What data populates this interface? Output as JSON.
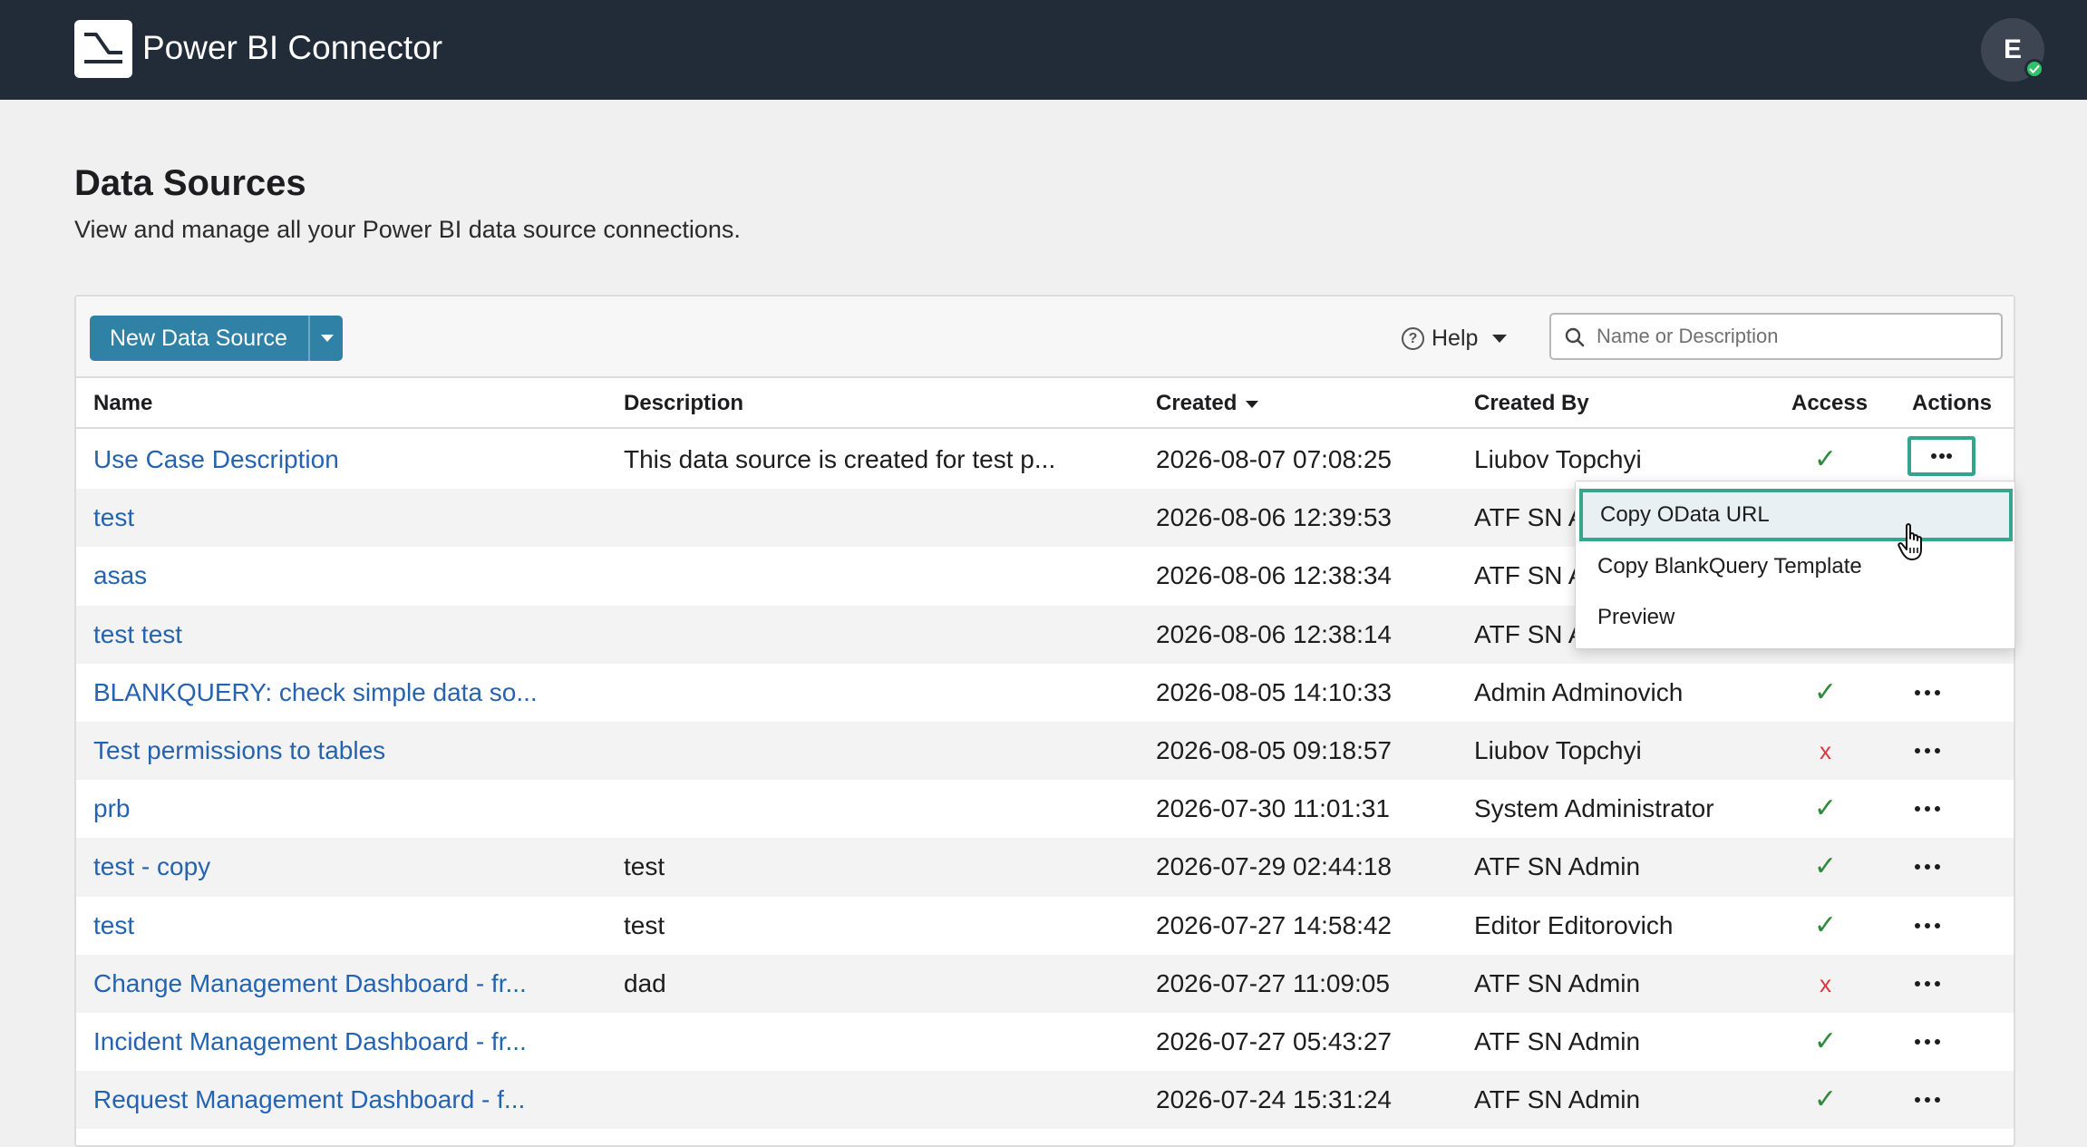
{
  "header": {
    "app_title": "Power BI Connector",
    "avatar_initial": "E",
    "colors": {
      "bar": "#222b38",
      "status": "#2ec26b"
    }
  },
  "page": {
    "title": "Data Sources",
    "subtitle": "View and manage all your Power BI data source connections."
  },
  "toolbar": {
    "new_button_label": "New Data Source",
    "help_label": "Help",
    "search_placeholder": "Name or Description",
    "search_value": ""
  },
  "table": {
    "columns": {
      "name": "Name",
      "description": "Description",
      "created": "Created",
      "created_by": "Created By",
      "access": "Access",
      "actions": "Actions"
    },
    "sort": {
      "column": "created",
      "direction": "desc"
    },
    "rows": [
      {
        "name": "Use Case Description",
        "description": "This data source is created for test p...",
        "created": "2026-08-07 07:08:25",
        "created_by": "Liubov Topchyi",
        "access": "✓"
      },
      {
        "name": "test",
        "description": "",
        "created": "2026-08-06 12:39:53",
        "created_by": "ATF SN Admin",
        "access": "✓"
      },
      {
        "name": "asas",
        "description": "",
        "created": "2026-08-06 12:38:34",
        "created_by": "ATF SN Admin",
        "access": "✓"
      },
      {
        "name": "test test",
        "description": "",
        "created": "2026-08-06 12:38:14",
        "created_by": "ATF SN Admin",
        "access": "✓"
      },
      {
        "name": "BLANKQUERY: check simple data so...",
        "description": "",
        "created": "2026-08-05 14:10:33",
        "created_by": "Admin Adminovich",
        "access": "✓"
      },
      {
        "name": "Test permissions to tables",
        "description": "",
        "created": "2026-08-05 09:18:57",
        "created_by": "Liubov Topchyi",
        "access": "x"
      },
      {
        "name": "prb",
        "description": "",
        "created": "2026-07-30 11:01:31",
        "created_by": "System Administrator",
        "access": "✓"
      },
      {
        "name": "test - copy",
        "description": "test",
        "created": "2026-07-29 02:44:18",
        "created_by": "ATF SN Admin",
        "access": "✓"
      },
      {
        "name": "test",
        "description": "test",
        "created": "2026-07-27 14:58:42",
        "created_by": "Editor Editorovich",
        "access": "✓"
      },
      {
        "name": "Change Management Dashboard - fr...",
        "description": "dad",
        "created": "2026-07-27 11:09:05",
        "created_by": "ATF SN Admin",
        "access": "x"
      },
      {
        "name": "Incident Management Dashboard - fr...",
        "description": "",
        "created": "2026-07-27 05:43:27",
        "created_by": "ATF SN Admin",
        "access": "✓"
      },
      {
        "name": "Request Management Dashboard - f...",
        "description": "",
        "created": "2026-07-24 15:31:24",
        "created_by": "ATF SN Admin",
        "access": "✓"
      }
    ]
  },
  "actions_menu": {
    "open_for_row": 0,
    "items": [
      {
        "label": "Copy OData URL",
        "highlighted": true
      },
      {
        "label": "Copy BlankQuery Template",
        "highlighted": false
      },
      {
        "label": "Preview",
        "highlighted": false
      }
    ]
  }
}
